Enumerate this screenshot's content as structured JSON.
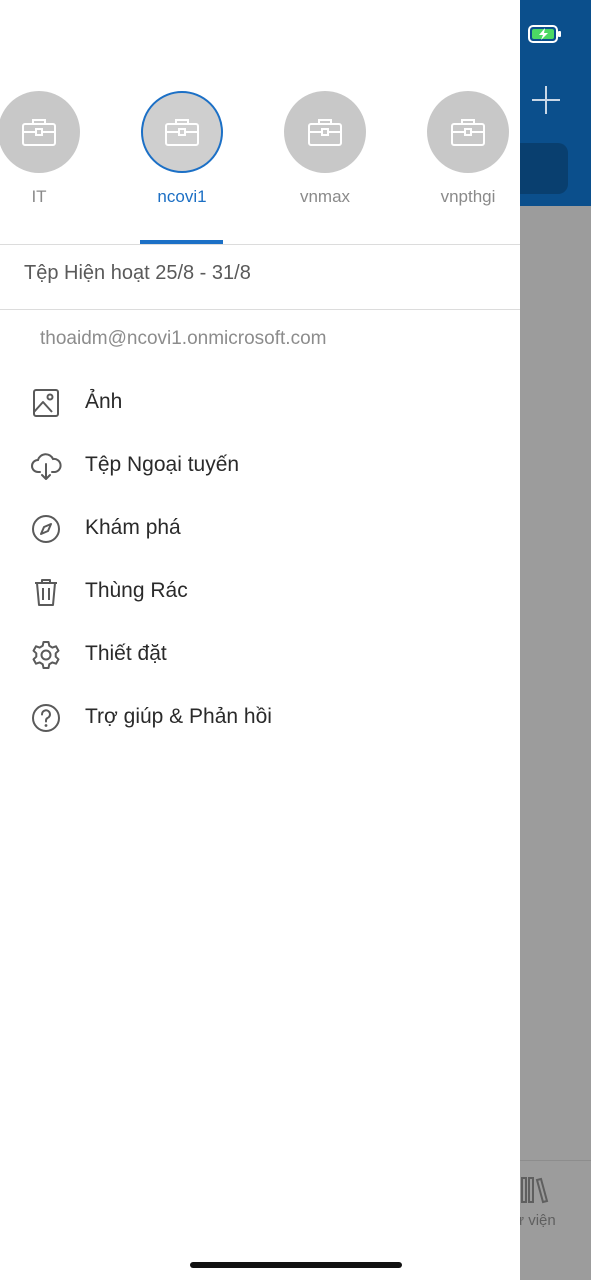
{
  "accounts": [
    {
      "label": "IT",
      "active": false
    },
    {
      "label": "ncovi1",
      "active": true
    },
    {
      "label": "vnmax",
      "active": false
    },
    {
      "label": "vnpthgi",
      "active": false
    }
  ],
  "recent_files": "Tệp Hiện hoạt 25/8 - 31/8",
  "email": "thoaidm@ncovi1.onmicrosoft.com",
  "menu": [
    {
      "label": "Ảnh",
      "icon": "image-icon"
    },
    {
      "label": "Tệp Ngoại tuyến",
      "icon": "cloud-download-icon"
    },
    {
      "label": "Khám phá",
      "icon": "compass-icon"
    },
    {
      "label": "Thùng Rác",
      "icon": "trash-icon"
    },
    {
      "label": "Thiết đặt",
      "icon": "gear-icon"
    },
    {
      "label": "Trợ giúp & Phản hồi",
      "icon": "help-icon"
    }
  ],
  "background": {
    "tab_label_partial": "ư viện"
  },
  "colors": {
    "accent": "#1c70c6",
    "header_blue": "#0b4f8c",
    "overlay_gray": "#9c9c9c"
  }
}
